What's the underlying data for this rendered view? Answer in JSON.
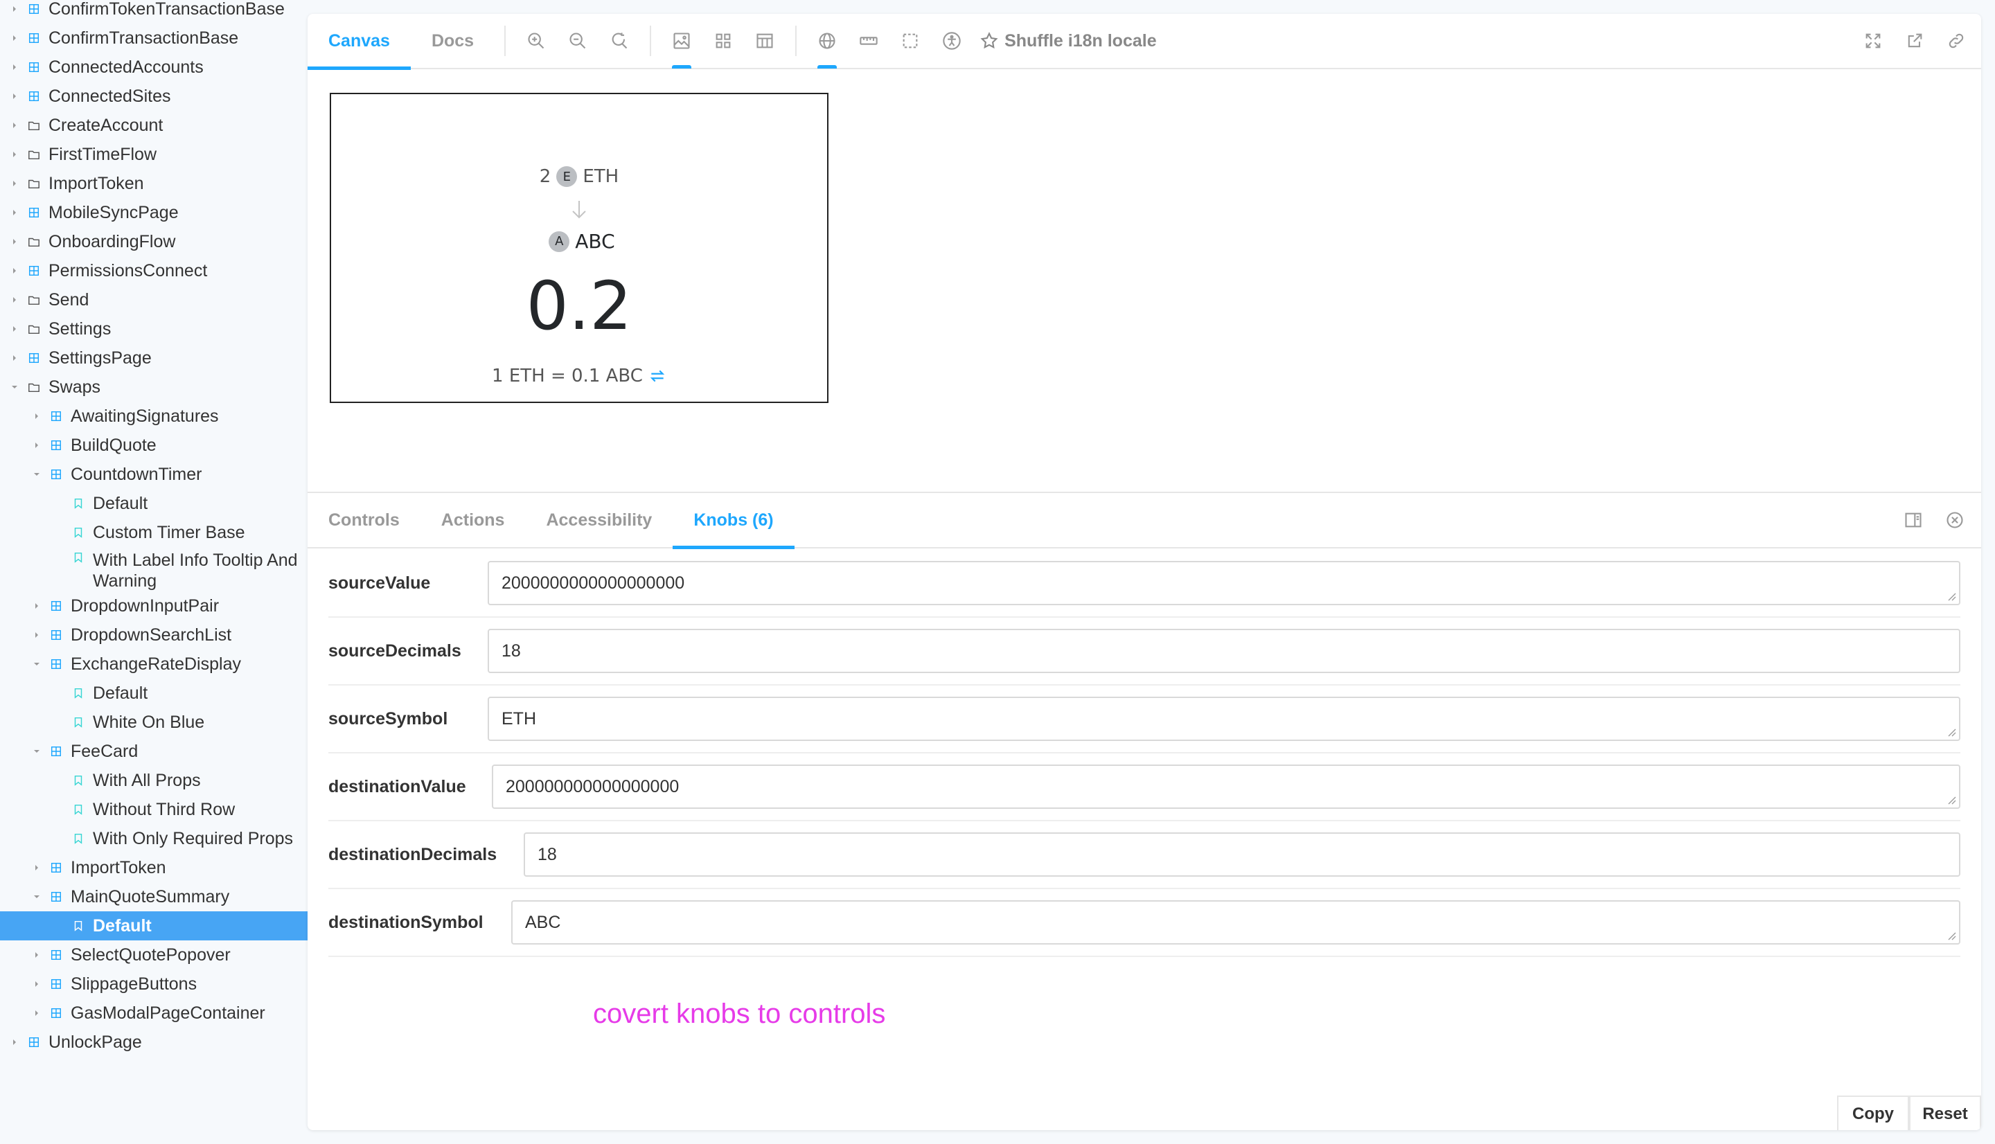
{
  "sidebar": {
    "items": [
      {
        "label": "ConfirmTokenTransactionBase",
        "kind": "component",
        "level": 0
      },
      {
        "label": "ConfirmTransactionBase",
        "kind": "component",
        "level": 0
      },
      {
        "label": "ConnectedAccounts",
        "kind": "component",
        "level": 0
      },
      {
        "label": "ConnectedSites",
        "kind": "component",
        "level": 0
      },
      {
        "label": "CreateAccount",
        "kind": "folder",
        "level": 0
      },
      {
        "label": "FirstTimeFlow",
        "kind": "folder",
        "level": 0
      },
      {
        "label": "ImportToken",
        "kind": "folder",
        "level": 0
      },
      {
        "label": "MobileSyncPage",
        "kind": "component",
        "level": 0
      },
      {
        "label": "OnboardingFlow",
        "kind": "folder",
        "level": 0
      },
      {
        "label": "PermissionsConnect",
        "kind": "component",
        "level": 0
      },
      {
        "label": "Send",
        "kind": "folder",
        "level": 0
      },
      {
        "label": "Settings",
        "kind": "folder",
        "level": 0
      },
      {
        "label": "SettingsPage",
        "kind": "component",
        "level": 0
      },
      {
        "label": "Swaps",
        "kind": "folder",
        "level": 0,
        "expanded": true
      },
      {
        "label": "AwaitingSignatures",
        "kind": "component",
        "level": 1
      },
      {
        "label": "BuildQuote",
        "kind": "component",
        "level": 1
      },
      {
        "label": "CountdownTimer",
        "kind": "component",
        "level": 1,
        "expanded": true
      },
      {
        "label": "Default",
        "kind": "story",
        "level": 2
      },
      {
        "label": "Custom Timer Base",
        "kind": "story",
        "level": 2
      },
      {
        "label": "With Label Info Tooltip And Warning",
        "kind": "story",
        "level": 2,
        "multiline": true
      },
      {
        "label": "DropdownInputPair",
        "kind": "component",
        "level": 1
      },
      {
        "label": "DropdownSearchList",
        "kind": "component",
        "level": 1
      },
      {
        "label": "ExchangeRateDisplay",
        "kind": "component",
        "level": 1,
        "expanded": true
      },
      {
        "label": "Default",
        "kind": "story",
        "level": 2
      },
      {
        "label": "White On Blue",
        "kind": "story",
        "level": 2
      },
      {
        "label": "FeeCard",
        "kind": "component",
        "level": 1,
        "expanded": true
      },
      {
        "label": "With All Props",
        "kind": "story",
        "level": 2
      },
      {
        "label": "Without Third Row",
        "kind": "story",
        "level": 2
      },
      {
        "label": "With Only Required Props",
        "kind": "story",
        "level": 2
      },
      {
        "label": "ImportToken",
        "kind": "component",
        "level": 1
      },
      {
        "label": "MainQuoteSummary",
        "kind": "component",
        "level": 1,
        "expanded": true
      },
      {
        "label": "Default",
        "kind": "story",
        "level": 2,
        "selected": true
      },
      {
        "label": "SelectQuotePopover",
        "kind": "component",
        "level": 1
      },
      {
        "label": "SlippageButtons",
        "kind": "component",
        "level": 1
      },
      {
        "label": "GasModalPageContainer",
        "kind": "component",
        "level": 1
      },
      {
        "label": "UnlockPage",
        "kind": "component",
        "level": 0
      }
    ]
  },
  "toolbar": {
    "tabs": [
      {
        "label": "Canvas",
        "active": true
      },
      {
        "label": "Docs",
        "active": false
      }
    ],
    "shuffle_label": "Shuffle i18n locale",
    "icons": [
      "zoom-in-icon",
      "zoom-out-icon",
      "reset-zoom-icon",
      "background-icon",
      "grid-icon",
      "outline-icon",
      "globe-icon",
      "ruler-icon",
      "measure-icon",
      "accessibility-icon",
      "star-icon",
      "fullscreen-icon",
      "open-new-tab-icon",
      "copy-link-icon"
    ]
  },
  "preview": {
    "source_amount": "2",
    "source_token_letter": "E",
    "source_symbol": "ETH",
    "dest_token_letter": "A",
    "dest_symbol": "ABC",
    "dest_amount": "0.2",
    "exchange_rate": "1 ETH = 0.1 ABC"
  },
  "addons": {
    "tabs": [
      {
        "label": "Controls",
        "active": false
      },
      {
        "label": "Actions",
        "active": false
      },
      {
        "label": "Accessibility",
        "active": false
      },
      {
        "label": "Knobs (6)",
        "active": true
      }
    ],
    "knobs": [
      {
        "name": "sourceValue",
        "value": "2000000000000000000"
      },
      {
        "name": "sourceDecimals",
        "value": "18"
      },
      {
        "name": "sourceSymbol",
        "value": "ETH"
      },
      {
        "name": "destinationValue",
        "value": "200000000000000000"
      },
      {
        "name": "destinationDecimals",
        "value": "18"
      },
      {
        "name": "destinationSymbol",
        "value": "ABC"
      }
    ],
    "annotation": "covert knobs to controls",
    "copy_label": "Copy",
    "reset_label": "Reset"
  },
  "colors": {
    "accent": "#1ea7fd",
    "selected_bg": "#47a5f4",
    "annotation": "#e63be8"
  }
}
